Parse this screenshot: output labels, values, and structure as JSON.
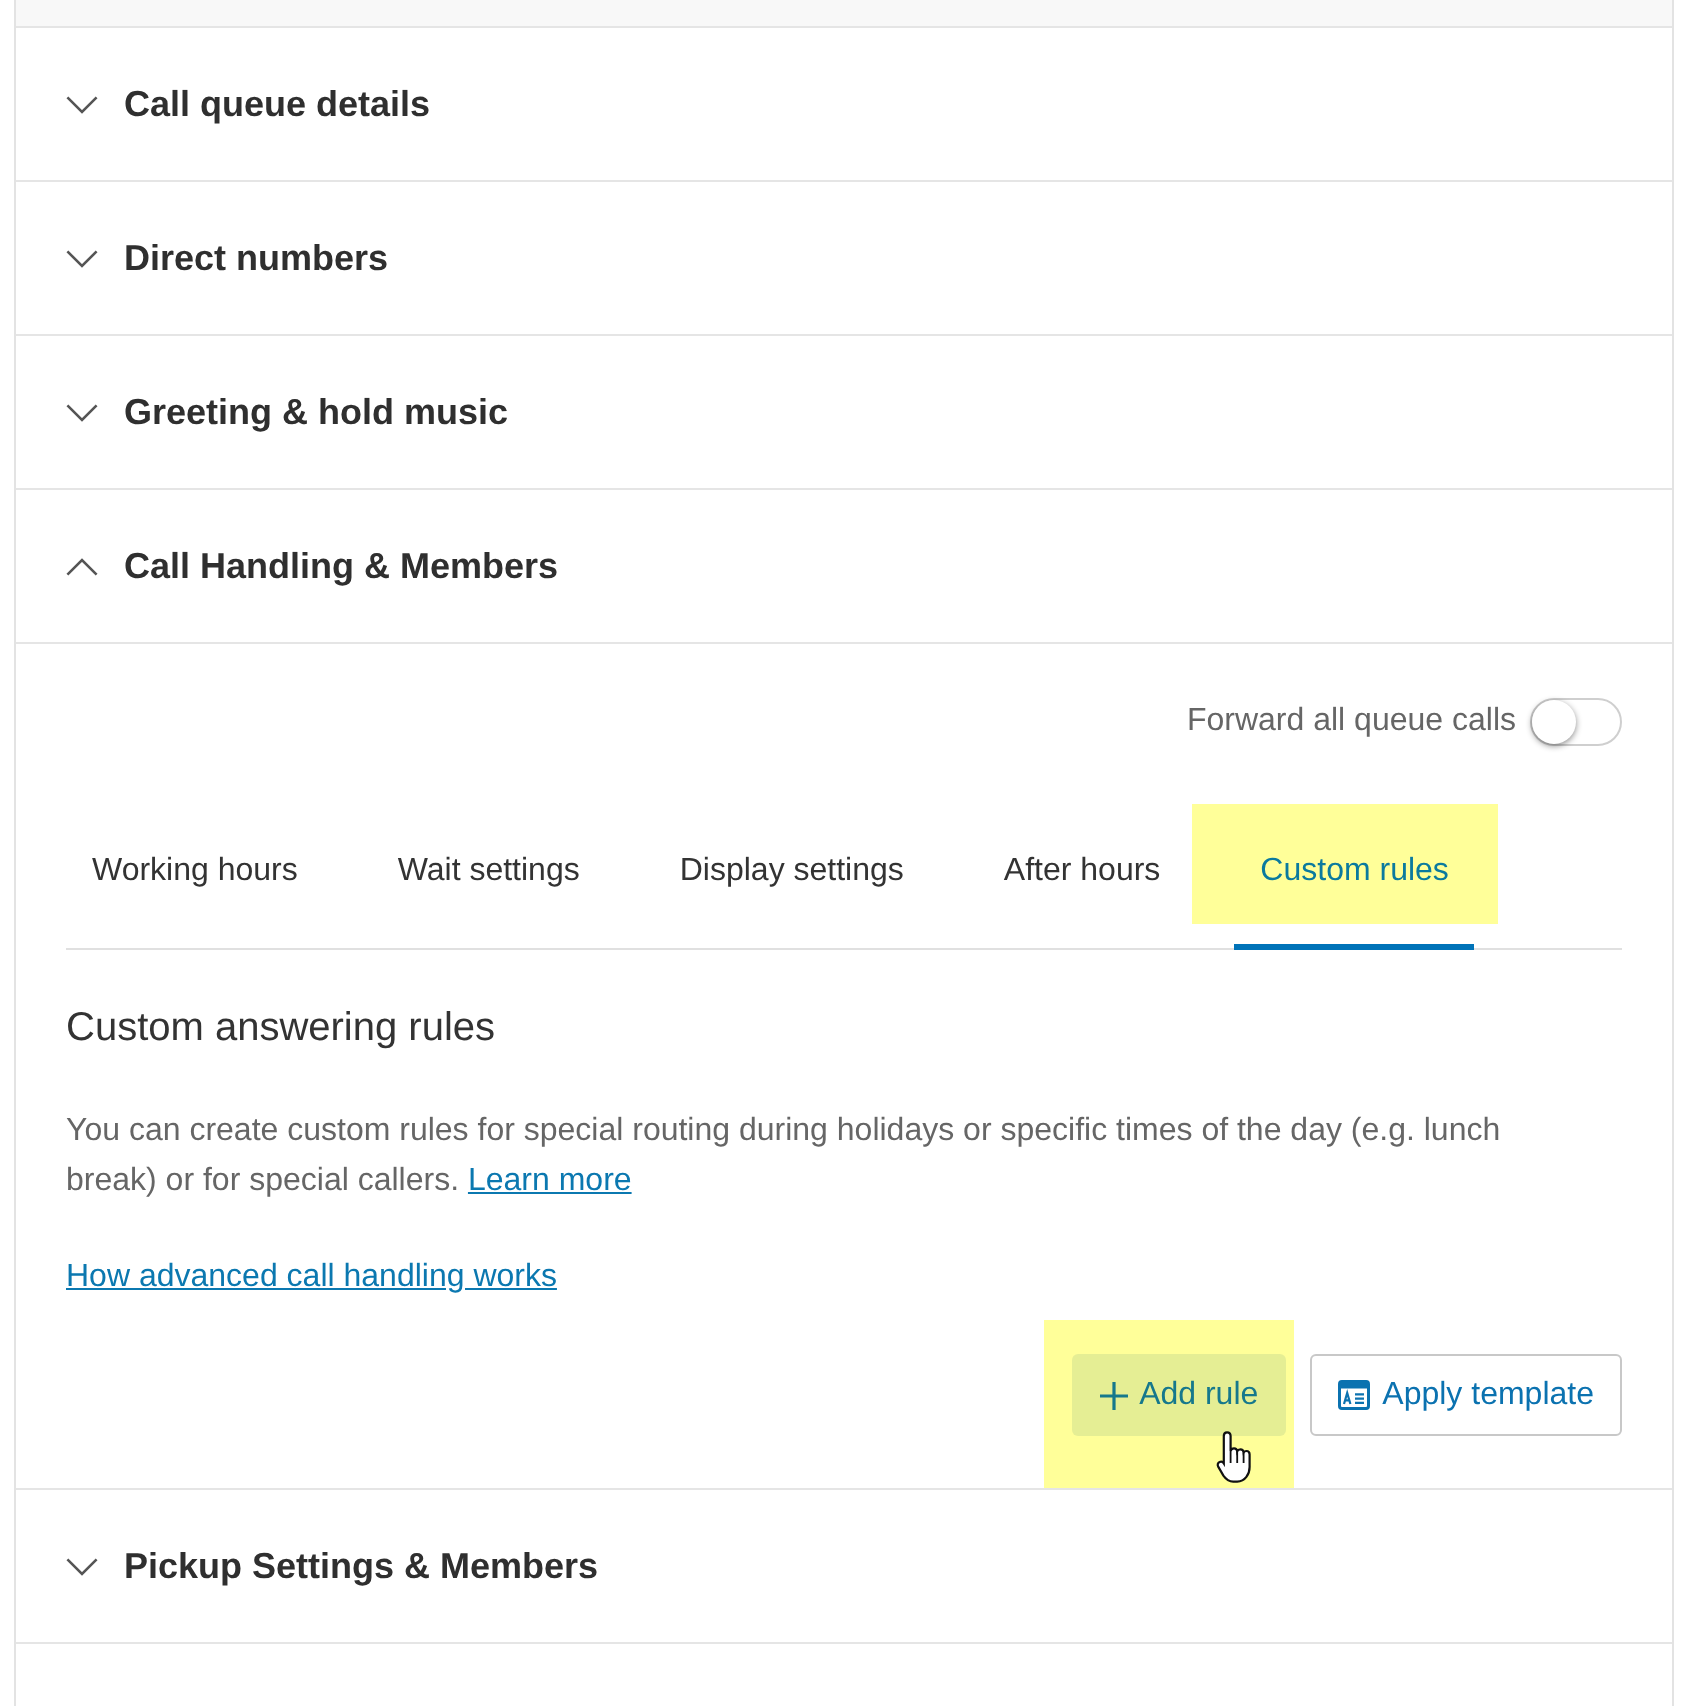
{
  "sections": [
    {
      "title": "Call queue details",
      "expanded": false
    },
    {
      "title": "Direct numbers",
      "expanded": false
    },
    {
      "title": "Greeting & hold music",
      "expanded": false
    },
    {
      "title": "Call Handling & Members",
      "expanded": true,
      "content": {
        "forward_toggle": {
          "label": "Forward all queue calls",
          "on": false
        },
        "tabs": [
          {
            "label": "Working hours",
            "selected": false,
            "highlighted": false
          },
          {
            "label": "Wait settings",
            "selected": false,
            "highlighted": false
          },
          {
            "label": "Display settings",
            "selected": false,
            "highlighted": false
          },
          {
            "label": "After hours",
            "selected": false,
            "highlighted": false
          },
          {
            "label": "Custom rules",
            "selected": true,
            "highlighted": true
          }
        ],
        "heading": "Custom answering rules",
        "description": "You can create custom rules for special routing during holidays or specific times of the day (e.g. lunch break) or for special callers.",
        "description_link": "Learn more",
        "link": "How advanced call handling works",
        "buttons": [
          {
            "kind": "add",
            "label": "Add rule",
            "highlighted": true,
            "hovered": true
          },
          {
            "kind": "template",
            "label": "Apply template",
            "highlighted": false,
            "hovered": false
          }
        ]
      }
    },
    {
      "title": "Pickup Settings & Members",
      "expanded": false
    }
  ]
}
